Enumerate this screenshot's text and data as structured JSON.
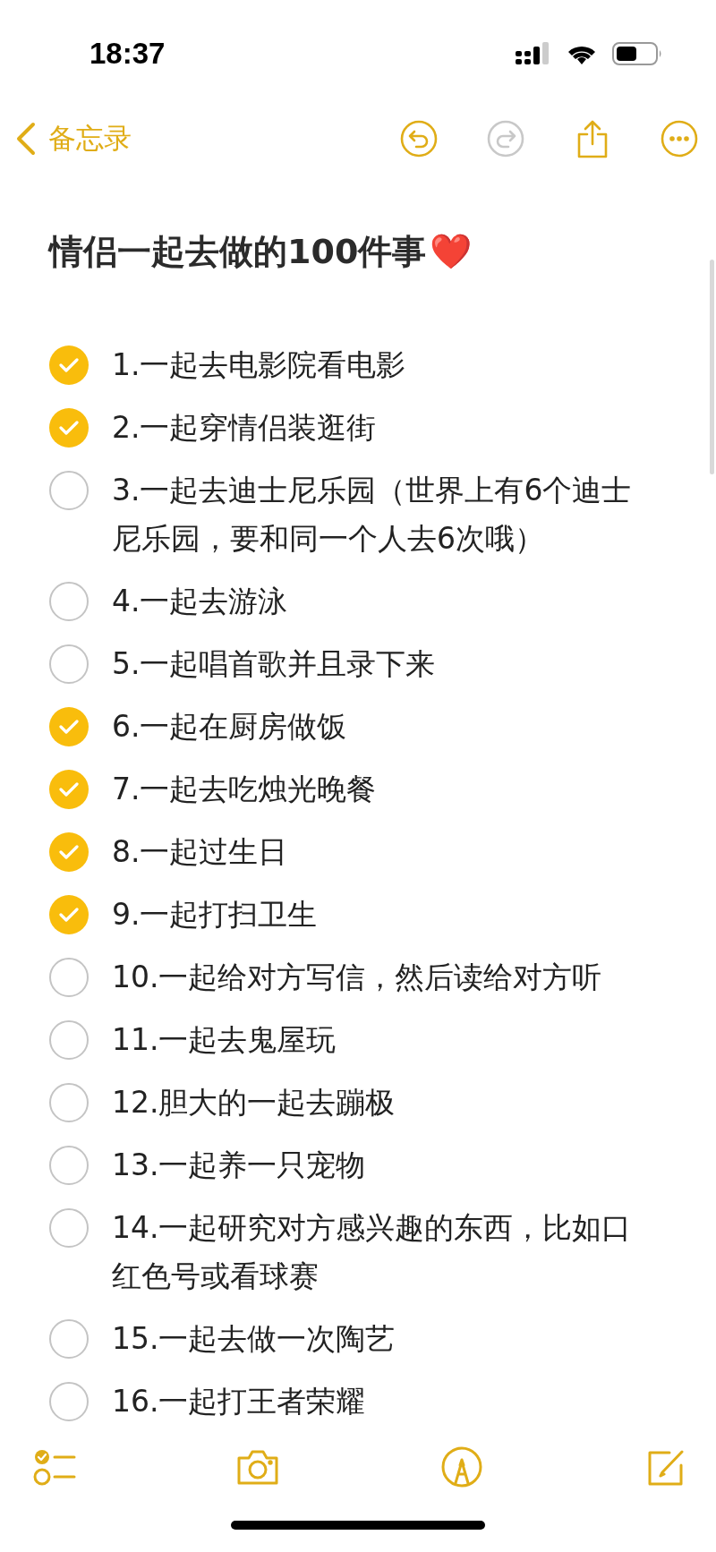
{
  "status_bar": {
    "time": "18:37"
  },
  "nav": {
    "back_label": "备忘录",
    "actions": [
      {
        "kind": "undo",
        "disabled": false
      },
      {
        "kind": "redo",
        "disabled": true
      },
      {
        "kind": "share",
        "disabled": false
      },
      {
        "kind": "more",
        "disabled": false
      }
    ]
  },
  "note": {
    "title": "情侣一起去做的100件事",
    "title_icon": "❤️",
    "items": [
      {
        "text": "1.一起去电影院看电影",
        "checked": true
      },
      {
        "text": "2.一起穿情侣装逛街",
        "checked": true
      },
      {
        "text": "3.一起去迪士尼乐园（世界上有6个迪士尼乐园，要和同一个人去6次哦）",
        "checked": false
      },
      {
        "text": "4.一起去游泳",
        "checked": false
      },
      {
        "text": "5.一起唱首歌并且录下来",
        "checked": false
      },
      {
        "text": "6.一起在厨房做饭",
        "checked": true
      },
      {
        "text": "7.一起去吃烛光晚餐",
        "checked": true
      },
      {
        "text": "8.一起过生日",
        "checked": true
      },
      {
        "text": "9.一起打扫卫生",
        "checked": true
      },
      {
        "text": "10.一起给对方写信，然后读给对方听",
        "checked": false
      },
      {
        "text": "11.一起去鬼屋玩",
        "checked": false
      },
      {
        "text": "12.胆大的一起去蹦极",
        "checked": false
      },
      {
        "text": "13.一起养一只宠物",
        "checked": false
      },
      {
        "text": "14.一起研究对方感兴趣的东西，比如口红色号或看球赛",
        "checked": false
      },
      {
        "text": "15.一起去做一次陶艺",
        "checked": false
      },
      {
        "text": "16.一起打王者荣耀",
        "checked": false
      }
    ]
  },
  "toolbar": {
    "tools": [
      {
        "kind": "checklist"
      },
      {
        "kind": "camera"
      },
      {
        "kind": "markup"
      },
      {
        "kind": "compose"
      }
    ]
  }
}
